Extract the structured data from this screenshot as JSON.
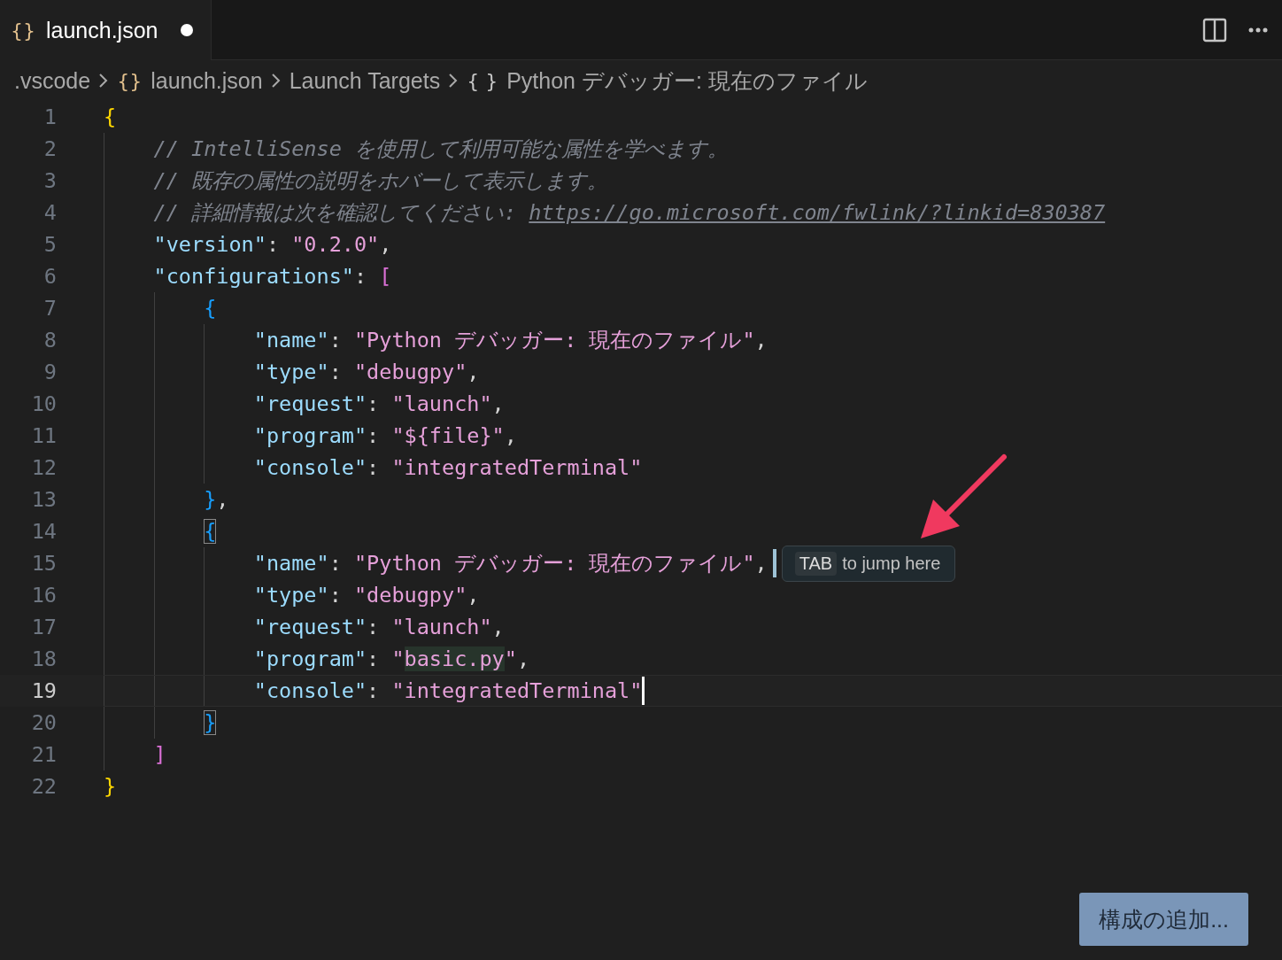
{
  "tab": {
    "icon": "{}",
    "label": "launch.json",
    "modified": true
  },
  "breadcrumbs": [
    {
      "label": ".vscode"
    },
    {
      "icon": "{}",
      "label": "launch.json"
    },
    {
      "label": "Launch Targets"
    },
    {
      "icon": "{ }",
      "label": "Python デバッガー: 現在のファイル"
    }
  ],
  "lines": [
    {
      "number": "1",
      "current": false,
      "tokens": [
        {
          "kind": "brace1",
          "text": "{"
        }
      ]
    },
    {
      "number": "2",
      "current": false,
      "tokens": [
        {
          "kind": "comment",
          "text": "// IntelliSense を使用して利用可能な属性を学べます。"
        }
      ]
    },
    {
      "number": "3",
      "current": false,
      "tokens": [
        {
          "kind": "comment",
          "text": "// 既存の属性の説明をホバーして表示します。"
        }
      ]
    },
    {
      "number": "4",
      "current": false,
      "tokens": [
        {
          "kind": "comment",
          "text": "// 詳細情報は次を確認してください: "
        },
        {
          "kind": "link",
          "text": "https://go.microsoft.com/fwlink/?linkid=830387"
        }
      ]
    },
    {
      "number": "5",
      "current": false,
      "tokens": [
        {
          "kind": "key",
          "text": "\"version\""
        },
        {
          "kind": "punct",
          "text": ": "
        },
        {
          "kind": "string",
          "text": "\"0.2.0\""
        },
        {
          "kind": "punct",
          "text": ","
        }
      ]
    },
    {
      "number": "6",
      "current": false,
      "tokens": [
        {
          "kind": "key",
          "text": "\"configurations\""
        },
        {
          "kind": "punct",
          "text": ": "
        },
        {
          "kind": "brace2",
          "text": "["
        }
      ]
    },
    {
      "number": "7",
      "current": false,
      "tokens": [
        {
          "kind": "brace3",
          "text": "{"
        }
      ]
    },
    {
      "number": "8",
      "current": false,
      "tokens": [
        {
          "kind": "key",
          "text": "\"name\""
        },
        {
          "kind": "punct",
          "text": ": "
        },
        {
          "kind": "string",
          "text": "\"Python デバッガー: 現在のファイル\""
        },
        {
          "kind": "punct",
          "text": ","
        }
      ]
    },
    {
      "number": "9",
      "current": false,
      "tokens": [
        {
          "kind": "key",
          "text": "\"type\""
        },
        {
          "kind": "punct",
          "text": ": "
        },
        {
          "kind": "string",
          "text": "\"debugpy\""
        },
        {
          "kind": "punct",
          "text": ","
        }
      ]
    },
    {
      "number": "10",
      "current": false,
      "tokens": [
        {
          "kind": "key",
          "text": "\"request\""
        },
        {
          "kind": "punct",
          "text": ": "
        },
        {
          "kind": "string",
          "text": "\"launch\""
        },
        {
          "kind": "punct",
          "text": ","
        }
      ]
    },
    {
      "number": "11",
      "current": false,
      "tokens": [
        {
          "kind": "key",
          "text": "\"program\""
        },
        {
          "kind": "punct",
          "text": ": "
        },
        {
          "kind": "string",
          "text": "\"${file}\""
        },
        {
          "kind": "punct",
          "text": ","
        }
      ]
    },
    {
      "number": "12",
      "current": false,
      "tokens": [
        {
          "kind": "key",
          "text": "\"console\""
        },
        {
          "kind": "punct",
          "text": ": "
        },
        {
          "kind": "string",
          "text": "\"integratedTerminal\""
        }
      ]
    },
    {
      "number": "13",
      "current": false,
      "tokens": [
        {
          "kind": "brace3",
          "text": "}"
        },
        {
          "kind": "punct",
          "text": ","
        }
      ]
    },
    {
      "number": "14",
      "current": false,
      "tokens": [
        {
          "kind": "brace3",
          "text": "{",
          "matched": true
        }
      ]
    },
    {
      "number": "15",
      "current": false,
      "tab_stop": true,
      "tokens": [
        {
          "kind": "key",
          "text": "\"name\""
        },
        {
          "kind": "punct",
          "text": ": "
        },
        {
          "kind": "string",
          "text": "\"Python デバッガー: 現在のファイル\""
        },
        {
          "kind": "punct",
          "text": ","
        }
      ],
      "hint": {
        "key": "TAB",
        "text": "to jump here"
      }
    },
    {
      "number": "16",
      "current": false,
      "tokens": [
        {
          "kind": "key",
          "text": "\"type\""
        },
        {
          "kind": "punct",
          "text": ": "
        },
        {
          "kind": "string",
          "text": "\"debugpy\""
        },
        {
          "kind": "punct",
          "text": ","
        }
      ]
    },
    {
      "number": "17",
      "current": false,
      "tokens": [
        {
          "kind": "key",
          "text": "\"request\""
        },
        {
          "kind": "punct",
          "text": ": "
        },
        {
          "kind": "string",
          "text": "\"launch\""
        },
        {
          "kind": "punct",
          "text": ","
        }
      ]
    },
    {
      "number": "18",
      "current": false,
      "tokens": [
        {
          "kind": "key",
          "text": "\"program\""
        },
        {
          "kind": "punct",
          "text": ": "
        },
        {
          "kind": "string",
          "text": "\""
        },
        {
          "kind": "string",
          "text": "basic.py",
          "placeholder": true
        },
        {
          "kind": "string",
          "text": "\""
        },
        {
          "kind": "punct",
          "text": ","
        }
      ]
    },
    {
      "number": "19",
      "current": true,
      "cursor": true,
      "tokens": [
        {
          "kind": "key",
          "text": "\"console\""
        },
        {
          "kind": "punct",
          "text": ": "
        },
        {
          "kind": "string",
          "text": "\"integratedTerminal\""
        }
      ]
    },
    {
      "number": "20",
      "current": false,
      "tokens": [
        {
          "kind": "brace3",
          "text": "}",
          "matched": true
        }
      ]
    },
    {
      "number": "21",
      "current": false,
      "tokens": [
        {
          "kind": "brace2",
          "text": "]"
        }
      ]
    },
    {
      "number": "22",
      "current": false,
      "tokens": [
        {
          "kind": "brace1",
          "text": "}"
        }
      ]
    }
  ],
  "add_configuration_button": "構成の追加..."
}
